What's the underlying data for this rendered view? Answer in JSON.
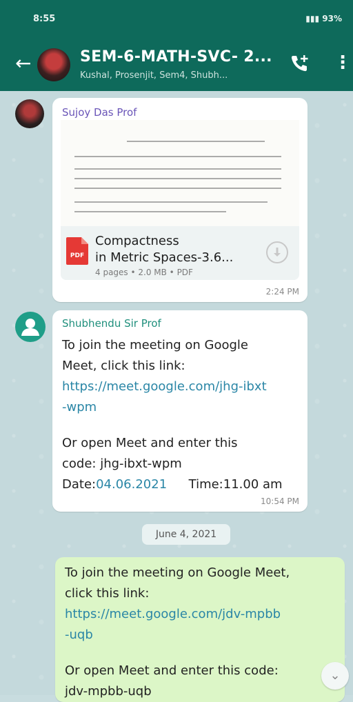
{
  "status_bar": {
    "time": "8:55",
    "system_info": "93%"
  },
  "header": {
    "back_icon": "arrow-left-icon",
    "title": "SEM-6-MATH-SVC- 2...",
    "participants": "Kushal, Prosenjit, Sem4, Shubh...",
    "call_icon": "add-call-icon",
    "menu_icon": "more-vertical-icon"
  },
  "messages": [
    {
      "sender": "Sujoy Das Prof",
      "file": {
        "name_line1": "Compactness",
        "name_line2": "in Metric Spaces-3.6...",
        "meta": "4 pages • 2.0 MB • PDF",
        "icon": "pdf-icon",
        "download_icon": "download-icon"
      },
      "time": "2:24 PM"
    },
    {
      "sender": "Shubhendu Sir Prof",
      "line1": "To join the meeting on Google",
      "line2": "Meet, click this link:",
      "link1": "https://meet.google.com/jhg-ibxt",
      "link2": "-wpm",
      "line3": "Or open Meet and enter this",
      "line4": "code: jhg-ibxt-wpm",
      "date_label": "Date:",
      "date_value": "04.06.2021",
      "time_label": "Time:11.00 am",
      "time": "10:54 PM"
    },
    {
      "line1": "To join the meeting on Google Meet,",
      "line2": "click this link:",
      "link1": "https://meet.google.com/jdv-mpbb",
      "link2": "-uqb",
      "line3": "Or open Meet and enter this code:",
      "line4": "jdv-mpbb-uqb"
    }
  ],
  "date_separator": "June 4, 2021",
  "scroll_icon": "chevron-double-down-icon",
  "colors": {
    "header": "#0e6a5b",
    "link": "#2a86a6",
    "outgoing_bubble": "#dcf6c7"
  }
}
